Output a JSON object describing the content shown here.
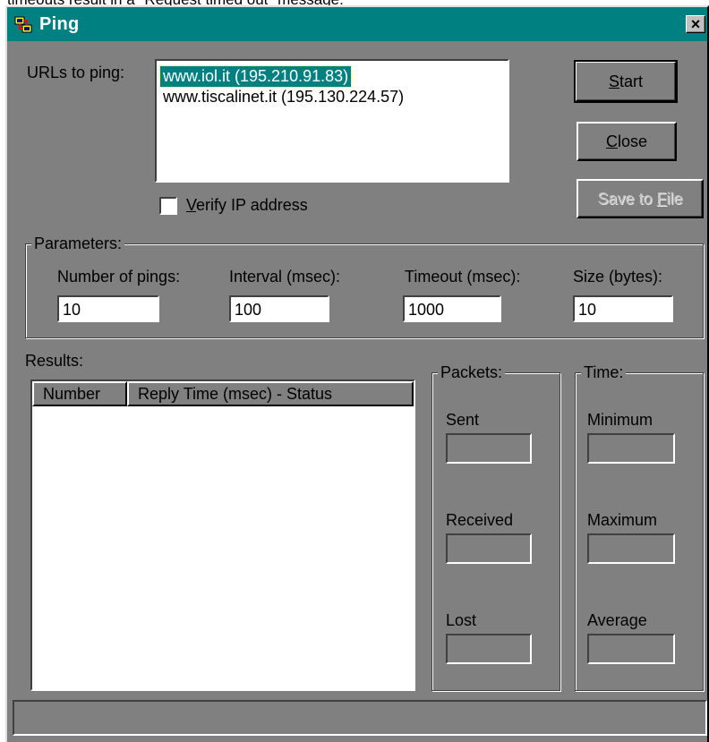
{
  "caption_above": "timeouts result in a \"Request timed out\" message.",
  "window": {
    "title": "Ping",
    "close_label": "×"
  },
  "urls": {
    "label": "URLs to ping:",
    "items": [
      {
        "text": "www.iol.it (195.210.91.83)",
        "selected": true
      },
      {
        "text": "www.tiscalinet.it (195.130.224.57)",
        "selected": false
      }
    ]
  },
  "verify": {
    "label_rest": "erify IP address",
    "label_accel": "V",
    "checked": false
  },
  "buttons": {
    "start_accel": "S",
    "start_rest": "tart",
    "close_accel": "C",
    "close_rest": "lose",
    "save_main": "Save to ",
    "save_accel": "F",
    "save_rest": "ile"
  },
  "parameters": {
    "group_label": "Parameters:",
    "fields": [
      {
        "label": "Number of pings:",
        "value": "10"
      },
      {
        "label": "Interval (msec):",
        "value": "100"
      },
      {
        "label": "Timeout (msec):",
        "value": "1000"
      },
      {
        "label": "Size (bytes):",
        "value": "10"
      }
    ]
  },
  "results": {
    "label": "Results:",
    "columns": [
      "Number",
      "Reply Time (msec) - Status"
    ]
  },
  "packets": {
    "group_label": "Packets:",
    "sent": "Sent",
    "received": "Received",
    "lost": "Lost"
  },
  "time": {
    "group_label": "Time:",
    "minimum": "Minimum",
    "maximum": "Maximum",
    "average": "Average"
  },
  "colors": {
    "title_bar": "#008080",
    "dialog_face": "#808080",
    "selection": "#008080"
  }
}
